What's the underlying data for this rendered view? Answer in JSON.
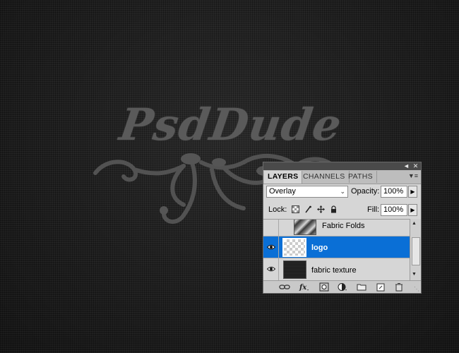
{
  "artwork": {
    "logo_text": "PsdDude",
    "colors": {
      "canvas": "#1f1f1f",
      "logo": "#5a5a5a"
    }
  },
  "layers_panel": {
    "tabs": [
      {
        "label": "LAYERS",
        "active": true
      },
      {
        "label": "CHANNELS",
        "active": false
      },
      {
        "label": "PATHS",
        "active": false
      }
    ],
    "blend_mode": "Overlay",
    "opacity_label": "Opacity:",
    "opacity_value": "100%",
    "lock_label": "Lock:",
    "fill_label": "Fill:",
    "fill_value": "100%",
    "layers": [
      {
        "name": "Fabric Folds",
        "visible": false,
        "selected": false
      },
      {
        "name": "logo",
        "visible": true,
        "selected": true
      },
      {
        "name": "fabric texture",
        "visible": true,
        "selected": false
      }
    ],
    "colors": {
      "selection": "#0a6fd6",
      "panel_bg": "#d6d6d6"
    }
  }
}
